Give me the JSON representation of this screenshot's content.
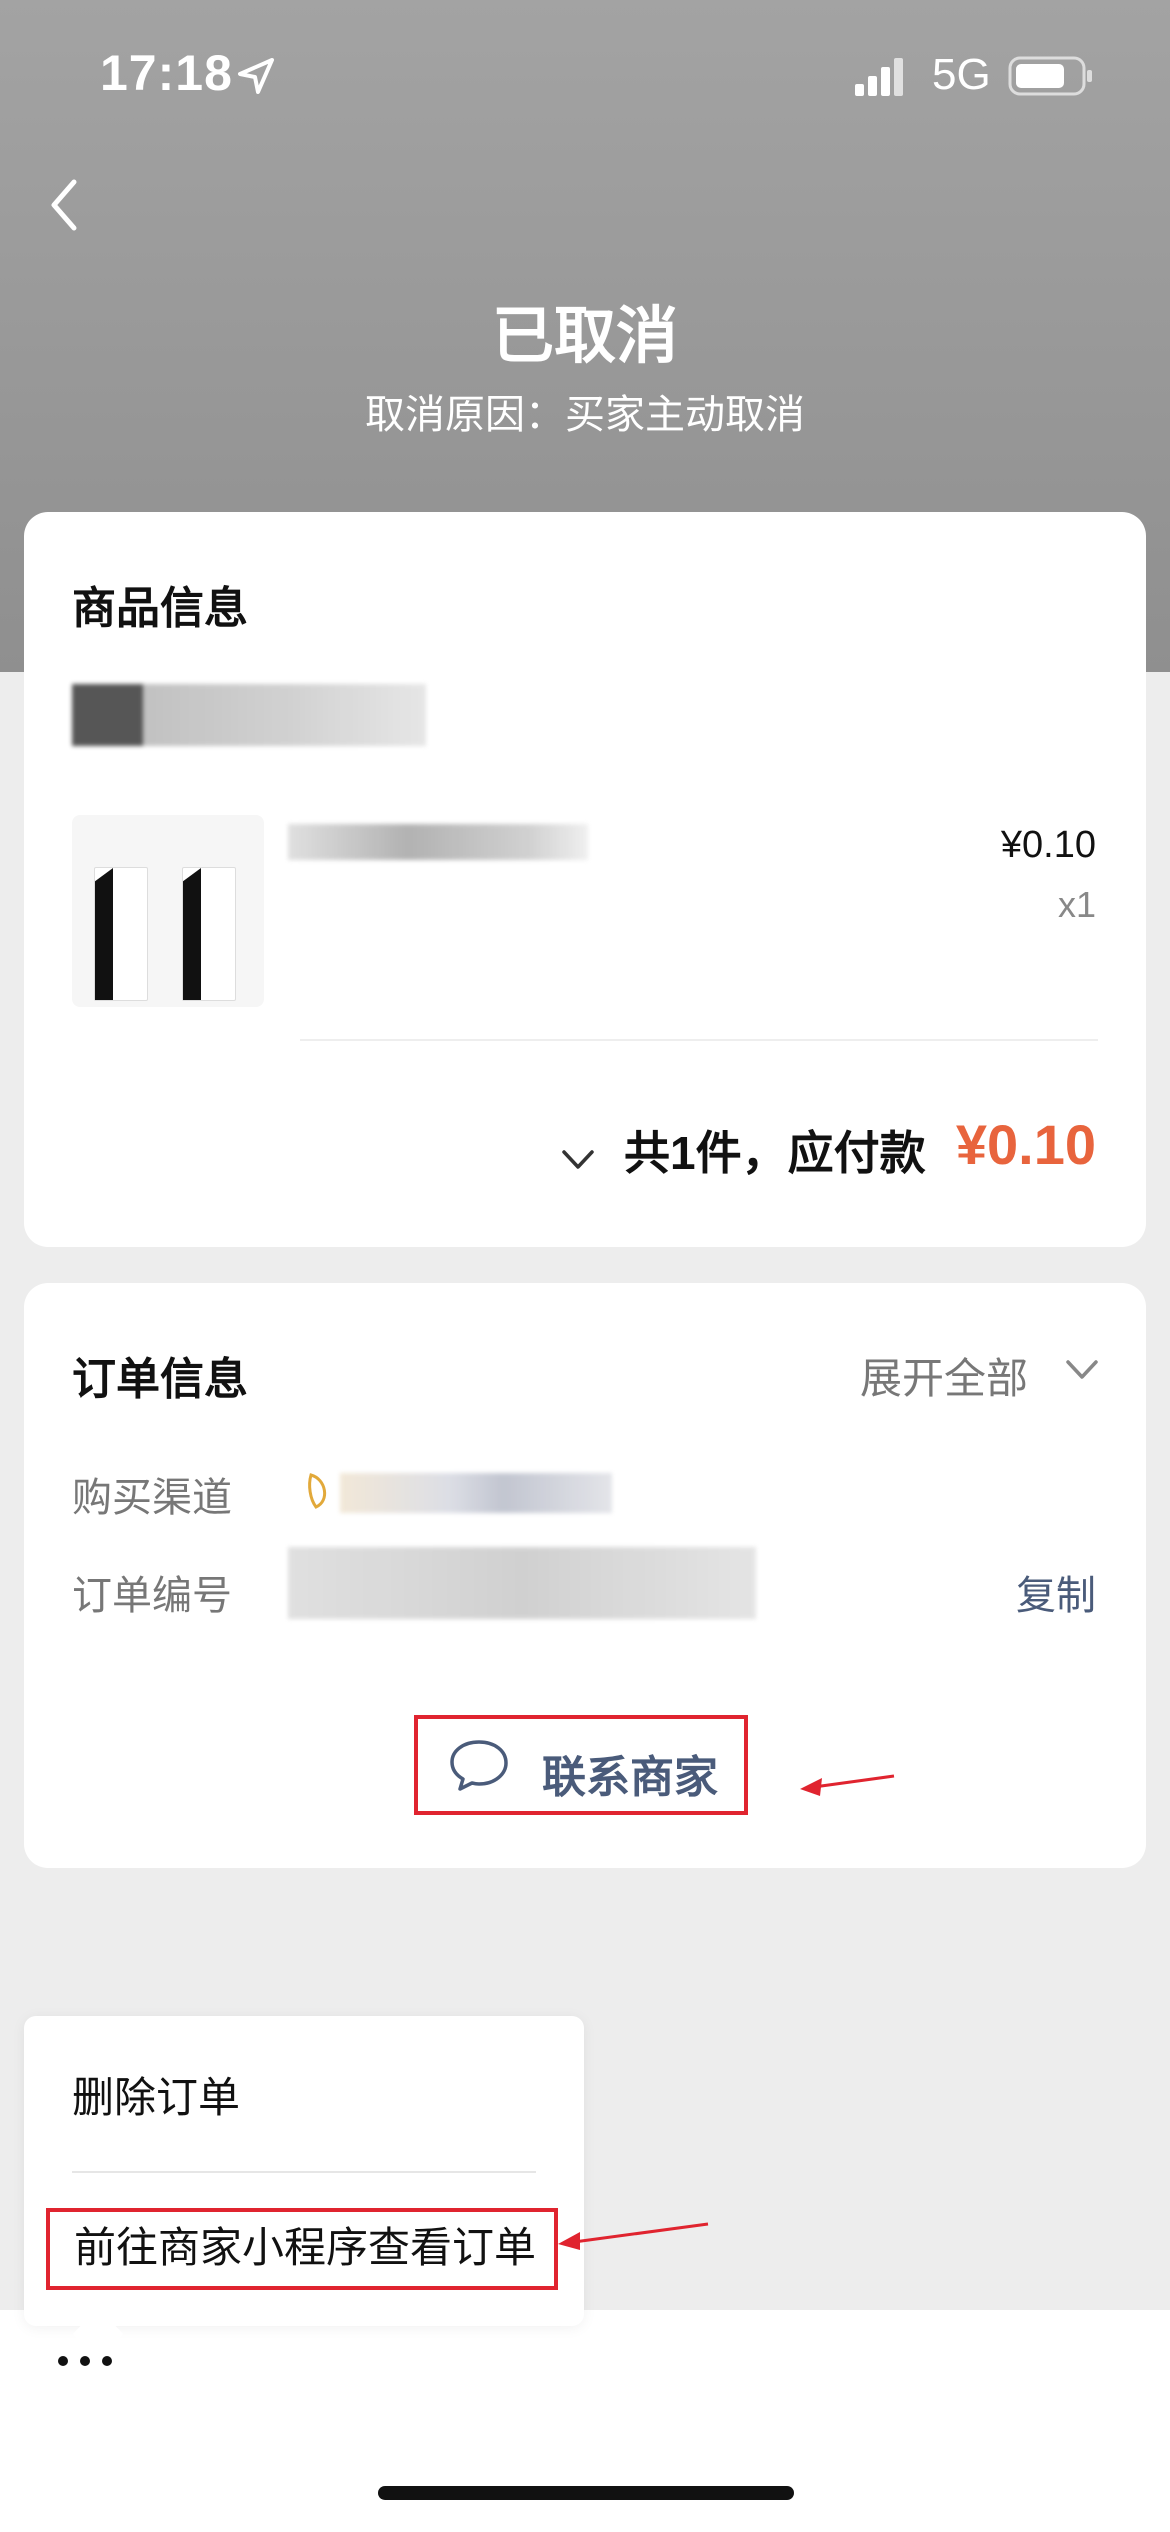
{
  "status_bar": {
    "time": "17:18",
    "network": "5G"
  },
  "header": {
    "title": "已取消",
    "subtitle": "取消原因：买家主动取消"
  },
  "product_card": {
    "title": "商品信息",
    "item": {
      "price": "¥0.10",
      "quantity": "x1"
    },
    "summary": {
      "label": "共1件，应付款",
      "amount": "¥0.10"
    }
  },
  "order_card": {
    "title": "订单信息",
    "expand_label": "展开全部",
    "rows": [
      {
        "label": "购买渠道"
      },
      {
        "label": "订单编号",
        "action": "复制"
      }
    ],
    "contact_label": "联系商家"
  },
  "menu": {
    "items": [
      "删除订单",
      "前往商家小程序查看订单"
    ]
  },
  "colors": {
    "accent_price": "#e8643d",
    "highlight_box": "#e0242f",
    "link": "#4a5b7a"
  }
}
